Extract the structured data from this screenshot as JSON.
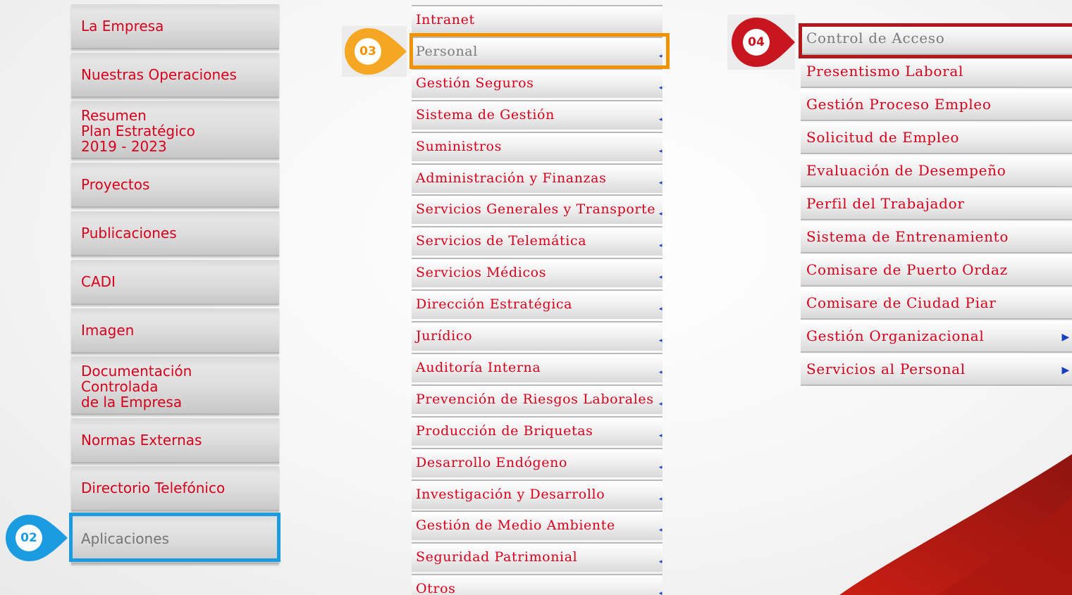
{
  "colors": {
    "menu_text": "#d6001c",
    "menu_text_active": "#757575",
    "arrow": "#1a3fbf",
    "step_02": "#1b9be0",
    "step_03": "#f39200",
    "step_04": "#b5161d"
  },
  "menu_level1": {
    "items": [
      {
        "label": "La Empresa"
      },
      {
        "label": "Nuestras Operaciones"
      },
      {
        "label": "Resumen\nPlan Estratégico\n2019 - 2023"
      },
      {
        "label": "Proyectos"
      },
      {
        "label": "Publicaciones"
      },
      {
        "label": "CADI"
      },
      {
        "label": "Imagen"
      },
      {
        "label": "Documentación\nControlada\nde la Empresa"
      },
      {
        "label": "Normas Externas"
      },
      {
        "label": "Directorio Telefónico"
      },
      {
        "label": "Aplicaciones",
        "selected": true
      }
    ]
  },
  "menu_level2": {
    "items": [
      {
        "label": "Intranet",
        "has_submenu": false
      },
      {
        "label": "Personal",
        "has_submenu": true,
        "selected": true
      },
      {
        "label": "Gestión Seguros",
        "has_submenu": true
      },
      {
        "label": "Sistema de Gestión",
        "has_submenu": true
      },
      {
        "label": "Suministros",
        "has_submenu": true
      },
      {
        "label": "Administración y Finanzas",
        "has_submenu": true
      },
      {
        "label": "Servicios Generales y Transporte",
        "has_submenu": true
      },
      {
        "label": "Servicios de Telemática",
        "has_submenu": true
      },
      {
        "label": "Servicios Médicos",
        "has_submenu": true
      },
      {
        "label": "Dirección Estratégica",
        "has_submenu": true
      },
      {
        "label": "Jurídico",
        "has_submenu": true
      },
      {
        "label": "Auditoría Interna",
        "has_submenu": true
      },
      {
        "label": "Prevención de Riesgos Laborales",
        "has_submenu": true
      },
      {
        "label": "Producción de Briquetas",
        "has_submenu": true
      },
      {
        "label": "Desarrollo Endógeno",
        "has_submenu": true
      },
      {
        "label": "Investigación y Desarrollo",
        "has_submenu": true
      },
      {
        "label": "Gestión de Medio Ambiente",
        "has_submenu": true
      },
      {
        "label": "Seguridad Patrimonial",
        "has_submenu": true
      },
      {
        "label": "Otros",
        "has_submenu": true
      }
    ]
  },
  "menu_level3": {
    "items": [
      {
        "label": "Control de Acceso",
        "has_submenu": false,
        "selected": true
      },
      {
        "label": "Presentismo Laboral",
        "has_submenu": false
      },
      {
        "label": "Gestión Proceso Empleo",
        "has_submenu": false
      },
      {
        "label": "Solicitud de Empleo",
        "has_submenu": false
      },
      {
        "label": "Evaluación de Desempeño",
        "has_submenu": false
      },
      {
        "label": "Perfil del Trabajador",
        "has_submenu": false
      },
      {
        "label": "Sistema de Entrenamiento",
        "has_submenu": false
      },
      {
        "label": "Comisare de Puerto Ordaz",
        "has_submenu": false
      },
      {
        "label": "Comisare de Ciudad Piar",
        "has_submenu": false
      },
      {
        "label": "Gestión Organizacional",
        "has_submenu": true
      },
      {
        "label": "Servicios al Personal",
        "has_submenu": true
      }
    ]
  },
  "markers": {
    "step_02": "02",
    "step_03": "03",
    "step_04": "04"
  }
}
